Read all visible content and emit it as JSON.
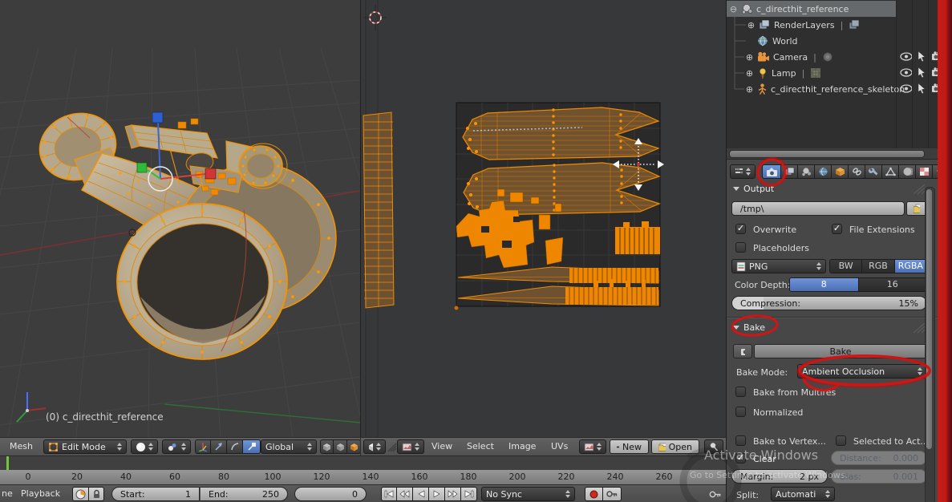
{
  "viewport": {
    "object_info": "(0) c_directhit_reference"
  },
  "header_3d": {
    "mesh_menu": "Mesh",
    "mode": "Edit Mode",
    "orientation": "Global"
  },
  "header_uv": {
    "view_menu": "View",
    "select_menu": "Select",
    "image_menu": "Image",
    "uvs_menu": "UVs",
    "new_button": "New",
    "open_button": "Open"
  },
  "outliner": {
    "items": [
      {
        "label": "c_directhit_reference"
      },
      {
        "label": "RenderLayers"
      },
      {
        "label": "World"
      },
      {
        "label": "Camera"
      },
      {
        "label": "Lamp"
      },
      {
        "label": "c_directhit_reference_skeleton"
      }
    ]
  },
  "properties": {
    "output_panel": {
      "title": "Output",
      "path_value": "/tmp\\",
      "overwrite_label": "Overwrite",
      "file_extensions_label": "File Extensions",
      "placeholders_label": "Placeholders",
      "format_value": "PNG",
      "channel_bw": "BW",
      "channel_rgb": "RGB",
      "channel_rgba": "RGBA",
      "color_depth_label": "Color Depth:",
      "depth_8": "8",
      "depth_16": "16",
      "compression_label": "Compression:",
      "compression_value": "15%"
    },
    "bake_panel": {
      "title": "Bake",
      "bake_button": "Bake",
      "mode_label": "Bake Mode:",
      "mode_value": "Ambient Occlusion",
      "multires_label": "Bake from Multires",
      "normalized_label": "Normalized",
      "vertex_label": "Bake to Vertex...",
      "selected_label": "Selected to Act...",
      "clear_label": "Clear",
      "distance_label": "Distance:",
      "distance_value": "0.000",
      "margin_label": "Margin:",
      "margin_value": "2 px",
      "bias_label": "Bias:",
      "bias_value": "0.001",
      "split_label": "Split:",
      "split_value": "Automati"
    }
  },
  "timeline": {
    "ticks": [
      "0",
      "20",
      "40",
      "60",
      "80",
      "100",
      "120",
      "140",
      "160",
      "180",
      "200",
      "220",
      "240",
      "260"
    ],
    "menu_partial": "ne",
    "playback_menu": "Playback",
    "start_label": "Start:",
    "start_value": "1",
    "end_label": "End:",
    "end_value": "250",
    "frame_value": "0",
    "sync_mode": "No Sync"
  },
  "watermark": {
    "line1": "Activate Windows",
    "line2": "Go to Settings to activate Windows."
  },
  "colors": {
    "selection_orange": "#ff9d00",
    "accent_blue": "#4e7ac7",
    "annotation_red": "#e01010"
  }
}
